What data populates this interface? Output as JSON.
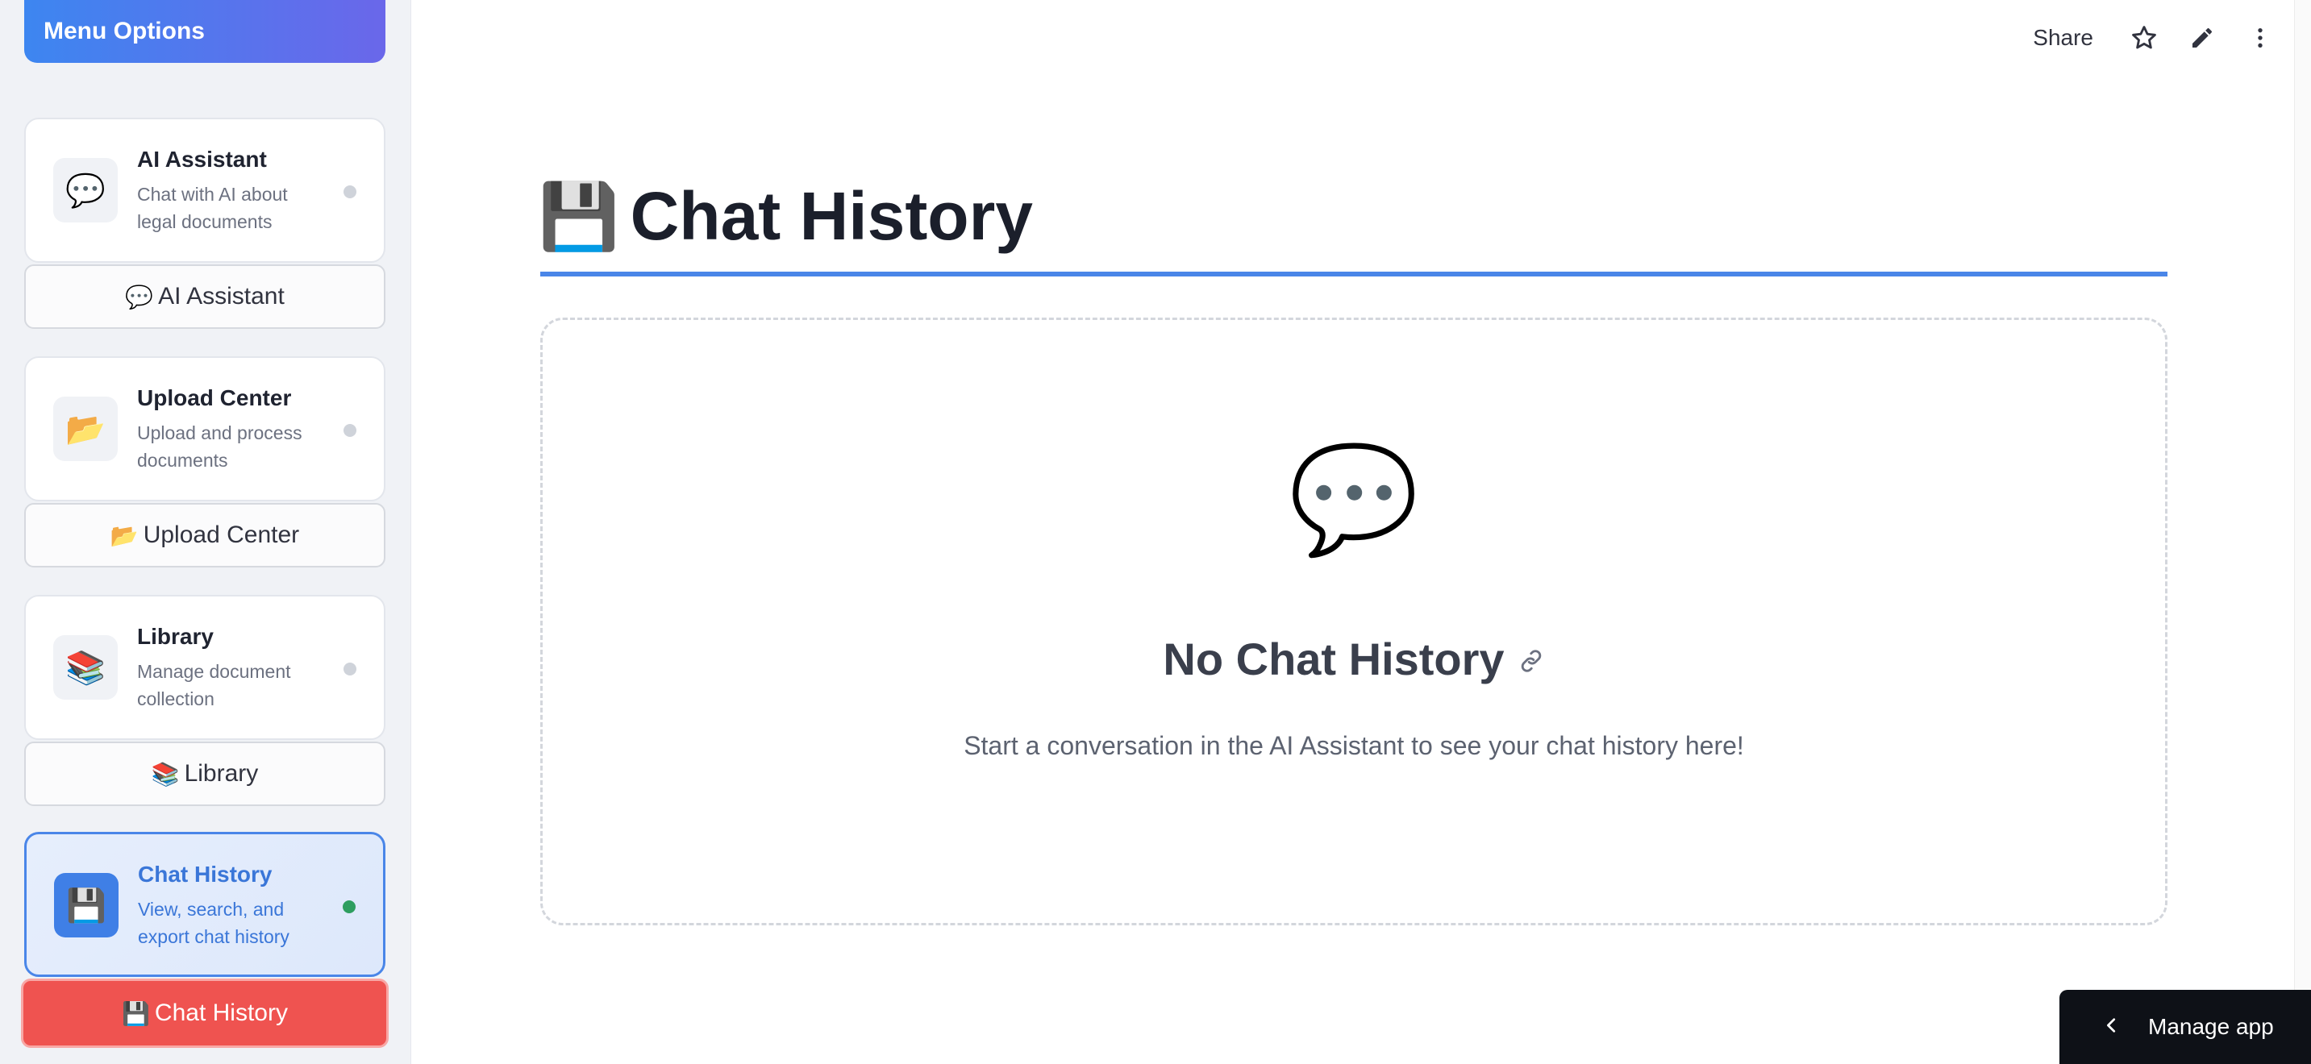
{
  "sidebar": {
    "header": "Menu Options",
    "items": [
      {
        "icon_emoji": "💬",
        "title": "AI Assistant",
        "desc": "Chat with AI about legal documents",
        "button_emoji": "💬",
        "button_label": "AI Assistant",
        "active": false
      },
      {
        "icon_emoji": "📂",
        "title": "Upload Center",
        "desc": "Upload and process documents",
        "button_emoji": "📂",
        "button_label": "Upload Center",
        "active": false
      },
      {
        "icon_emoji": "📚",
        "title": "Library",
        "desc": "Manage document collection",
        "button_emoji": "📚",
        "button_label": "Library",
        "active": false
      },
      {
        "icon_emoji": "💾",
        "title": "Chat History",
        "desc": "View, search, and export chat history",
        "button_emoji": "💾",
        "button_label": "Chat History",
        "active": true
      }
    ]
  },
  "toolbar": {
    "share_label": "Share",
    "icons": [
      "star-icon",
      "pencil-icon",
      "more-vertical-icon"
    ]
  },
  "main": {
    "title_emoji": "💾",
    "title": "Chat History",
    "empty": {
      "icon_emoji": "💬",
      "heading": "No Chat History",
      "text": "Start a conversation in the AI Assistant to see your chat history here!"
    }
  },
  "manage_app": {
    "label": "Manage app"
  },
  "colors": {
    "accent": "#4a86e8",
    "primary_button": "#ef5350",
    "header_gradient_start": "#3d86f0",
    "header_gradient_end": "#6a67ea",
    "active_dot": "#2e9e5f"
  }
}
